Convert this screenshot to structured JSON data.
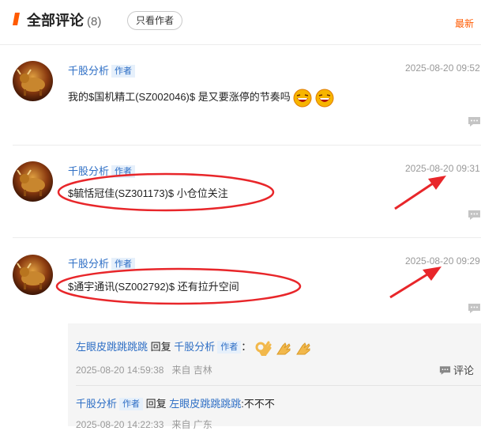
{
  "header": {
    "title": "全部评论",
    "count": "(8)",
    "author_only_button": "只看作者",
    "sort_label": "最新"
  },
  "comments": [
    {
      "author": "千股分析",
      "badge": "作者",
      "time": "2025-08-20 09:52",
      "text": "我的$国机精工(SZ002046)$ 是又要涨停的节奏吗"
    },
    {
      "author": "千股分析",
      "badge": "作者",
      "time": "2025-08-20 09:31",
      "text": "$毓恬冠佳(SZ301173)$ 小仓位关注"
    },
    {
      "author": "千股分析",
      "badge": "作者",
      "time": "2025-08-20 09:29",
      "text": "$通宇通讯(SZ002792)$ 还有拉升空间"
    }
  ],
  "replies": [
    {
      "from": "左眼皮跳跳跳跳",
      "reply_word": "回复",
      "to": "千股分析",
      "to_badge": "作者",
      "colon": "：",
      "text": "",
      "time": "2025-08-20 14:59:38",
      "source": "来自 吉林",
      "comment_label": "评论"
    },
    {
      "from": "千股分析",
      "from_badge": "作者",
      "reply_word": "回复",
      "to": "左眼皮跳跳跳跳",
      "text": ":不不不",
      "time": "2025-08-20 14:22:33",
      "source": "来自 广东"
    }
  ],
  "colors": {
    "accent": "#ff5a00",
    "link": "#2d6ec5",
    "annotation": "#e8262a"
  }
}
